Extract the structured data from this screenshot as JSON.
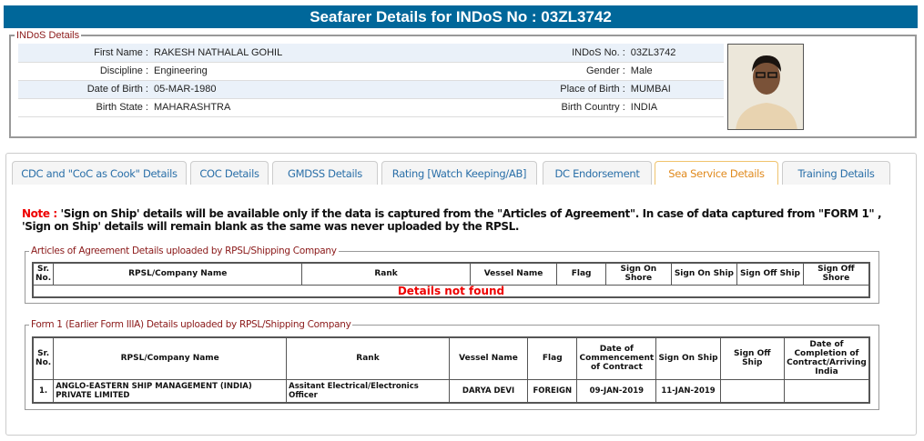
{
  "header": {
    "title": "Seafarer Details for INDoS No : 03ZL3742"
  },
  "indos": {
    "legend": "INDoS Details",
    "rows": [
      {
        "l1": "First Name :",
        "v1": "RAKESH NATHALAL GOHIL",
        "l2": "INDoS No. :",
        "v2": "03ZL3742"
      },
      {
        "l1": "Discipline :",
        "v1": "Engineering",
        "l2": "Gender :",
        "v2": "Male"
      },
      {
        "l1": "Date of Birth :",
        "v1": "05-MAR-1980",
        "l2": "Place of Birth :",
        "v2": "MUMBAI"
      },
      {
        "l1": "Birth State :",
        "v1": "MAHARASHTRA",
        "l2": "Birth Country :",
        "v2": "INDIA"
      }
    ]
  },
  "tabs": [
    {
      "label": "CDC and \"CoC as Cook\" Details"
    },
    {
      "label": "COC Details"
    },
    {
      "label": "GMDSS Details"
    },
    {
      "label": "Rating [Watch Keeping/AB]"
    },
    {
      "label": "DC Endorsement"
    },
    {
      "label": "Sea Service Details",
      "active": true
    },
    {
      "label": "Training Details"
    }
  ],
  "note": {
    "prefix": "Note :",
    "text": " 'Sign on Ship' details will be available only if the data is captured from the \"Articles of Agreement\". In case of data captured from \"FORM 1\" , 'Sign on Ship' details will remain blank as the same was never uploaded by the RPSL."
  },
  "articles": {
    "legend": "Articles of Agreement Details uploaded by RPSL/Shipping Company",
    "headers": [
      "Sr. No.",
      "RPSL/Company Name",
      "Rank",
      "Vessel Name",
      "Flag",
      "Sign On Shore",
      "Sign On Ship",
      "Sign Off Ship",
      "Sign Off Shore"
    ],
    "empty": "Details not found"
  },
  "form1": {
    "legend": "Form 1 (Earlier Form IIIA) Details uploaded by RPSL/Shipping Company",
    "headers": [
      "Sr. No.",
      "RPSL/Company Name",
      "Rank",
      "Vessel Name",
      "Flag",
      "Date of Commencement of Contract",
      "Sign On Ship",
      "Sign Off Ship",
      "Date of Completion of Contract/Arriving India"
    ],
    "rows": [
      [
        "1.",
        "ANGLO-EASTERN SHIP MANAGEMENT (INDIA) PRIVATE LIMITED",
        "Assitant Electrical/Electronics Officer",
        "DARYA DEVI",
        "FOREIGN",
        "09-JAN-2019",
        "11-JAN-2019",
        "",
        ""
      ]
    ]
  }
}
